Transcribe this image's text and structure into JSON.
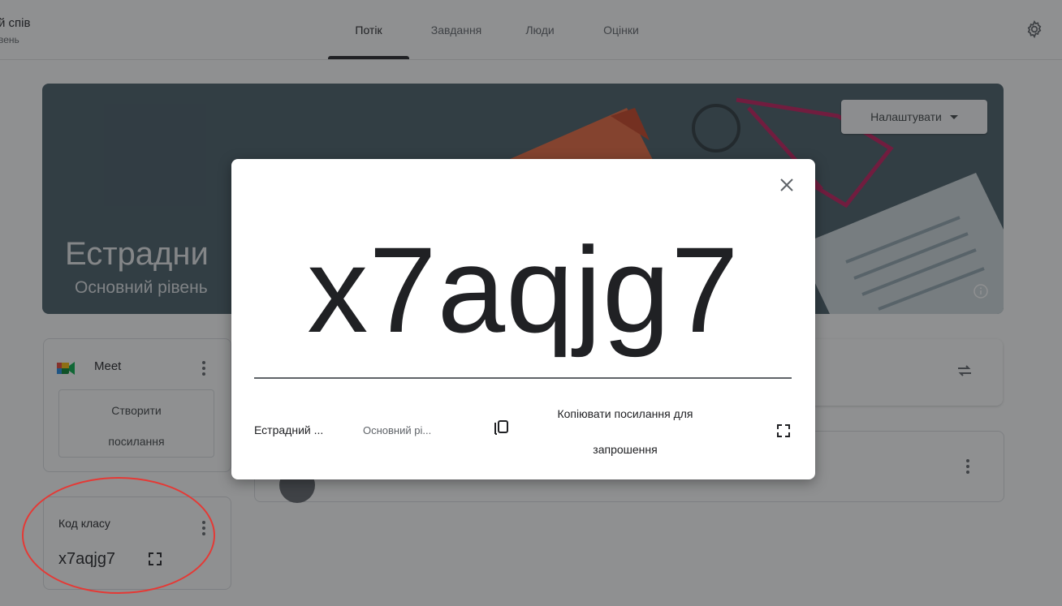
{
  "header": {
    "class_title": "й спів",
    "class_subtitle": "вень",
    "tabs": [
      {
        "label": "Потік",
        "active": true
      },
      {
        "label": "Завдання",
        "active": false
      },
      {
        "label": "Люди",
        "active": false
      },
      {
        "label": "Оцінки",
        "active": false
      }
    ],
    "settings_icon": "gear-icon"
  },
  "banner": {
    "title": "Естрадни",
    "subtitle": "Основний рівень",
    "customize_label": "Налаштувати",
    "info_icon": "info-icon",
    "background_color": "#455a64"
  },
  "meet": {
    "label": "Meet",
    "create_link_label_line1": "Створити",
    "create_link_label_line2": "посилання"
  },
  "class_code_card": {
    "label": "Код класу",
    "code": "x7aqjg7"
  },
  "dialog": {
    "code": "x7aqjg7",
    "class_name": "Естрадний ...",
    "class_subtitle": "Основний рі...",
    "copy_link_line1": "Копіювати посилання для",
    "copy_link_line2": "запрошення",
    "close_icon": "close-icon",
    "fullscreen_icon": "fullscreen-icon"
  },
  "colors": {
    "accent_text": "#202124",
    "secondary_text": "#5f6368",
    "annotation_circle": "#e53935"
  }
}
